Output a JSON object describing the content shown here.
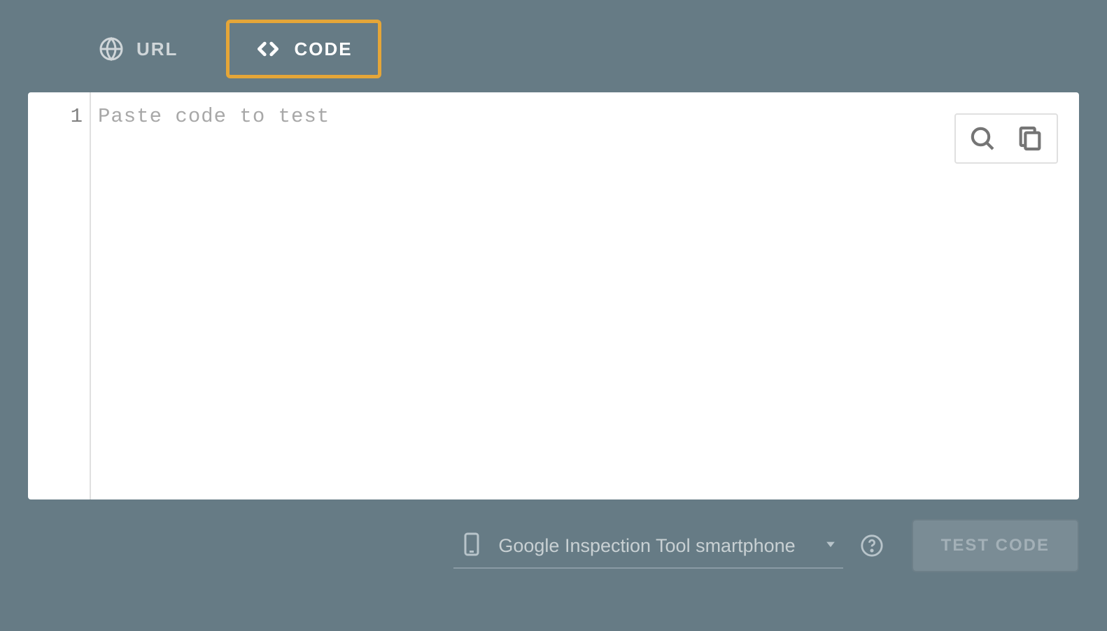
{
  "tabs": {
    "url": {
      "label": "URL"
    },
    "code": {
      "label": "CODE"
    }
  },
  "editor": {
    "line_number": "1",
    "placeholder": "Paste code to test"
  },
  "footer": {
    "device": "Google Inspection Tool smartphone",
    "test_button": "TEST CODE"
  }
}
